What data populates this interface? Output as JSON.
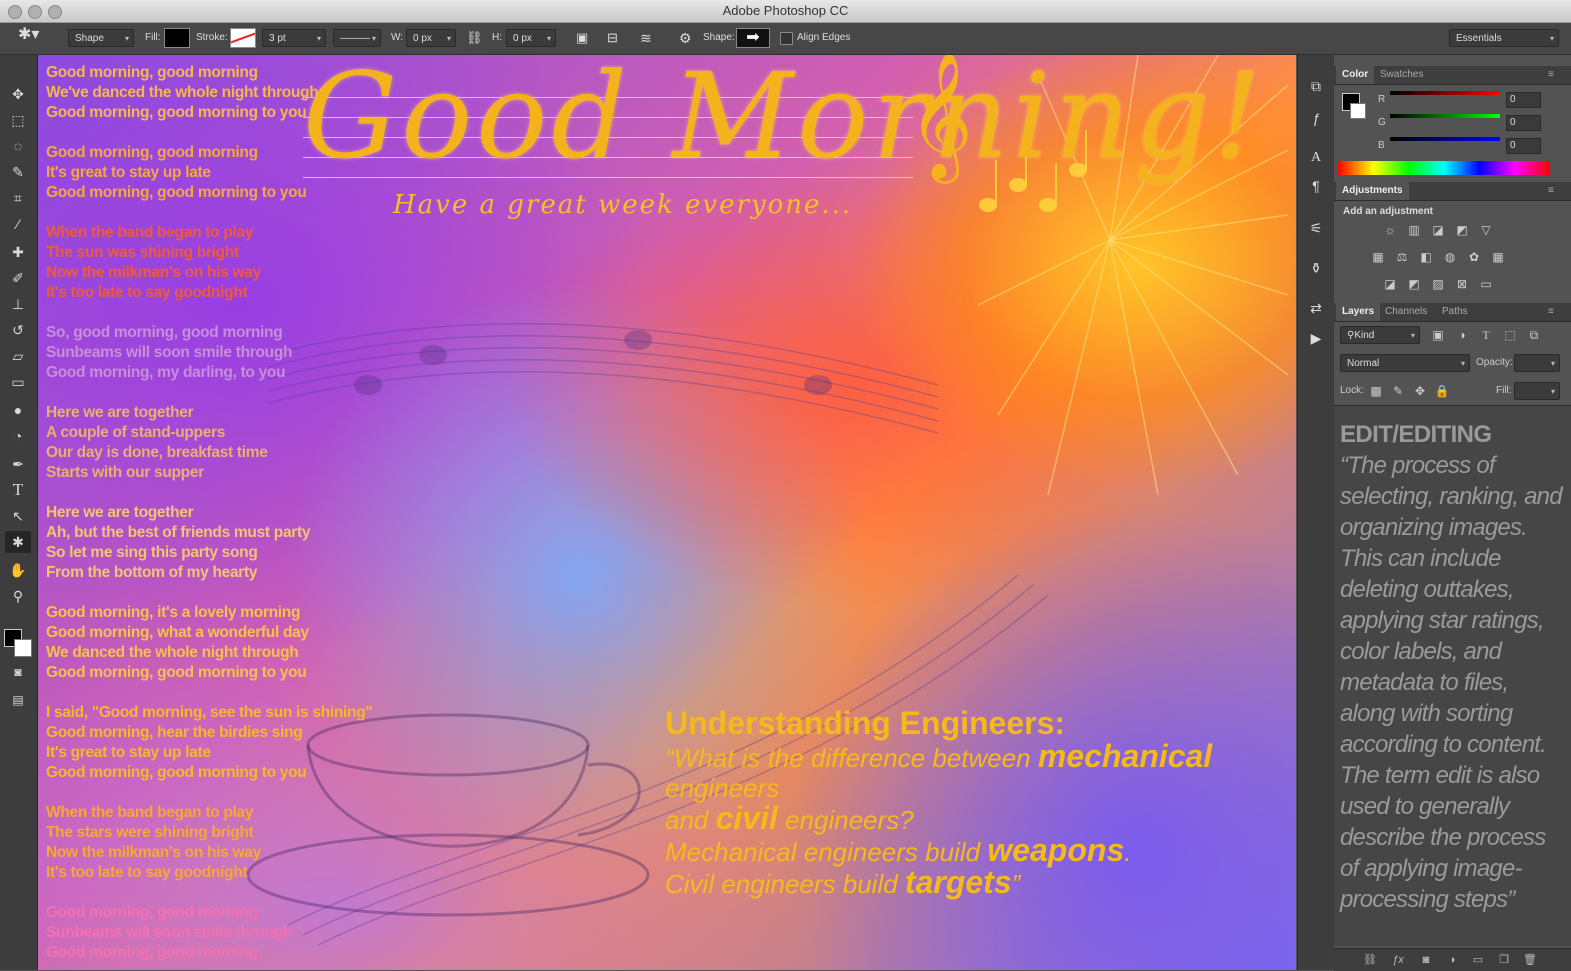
{
  "window": {
    "title": "Adobe Photoshop CC"
  },
  "options_bar": {
    "mode": "Shape",
    "fill_label": "Fill:",
    "stroke_label": "Stroke:",
    "stroke_width": "3 pt",
    "w_label": "W:",
    "w_value": "0 px",
    "h_label": "H:",
    "h_value": "0 px",
    "shape_label": "Shape:",
    "align_edges": "Align Edges",
    "workspace": "Essentials"
  },
  "canvas": {
    "lyrics": [
      {
        "color": "#f7b84a",
        "lines": [
          "Good morning, good morning",
          "We've danced the whole night through",
          "Good morning, good morning to you"
        ]
      },
      {
        "color": "#f7a83a",
        "lines": [
          "Good morning, good morning",
          "It's great to stay up late",
          "Good morning, good morning to you"
        ]
      },
      {
        "color": "#f05a3a",
        "lines": [
          "When the band began to play",
          "The sun was shining bright",
          "Now the milkman's on his way",
          "It's too late to say goodnight"
        ]
      },
      {
        "color": "#c88ed8",
        "lines": [
          "So, good morning, good morning",
          "Sunbeams will soon smile through",
          "Good morning, my darling, to you"
        ]
      },
      {
        "color": "#e9b070",
        "lines": [
          "Here we are together",
          "A couple of stand-uppers",
          "Our day is done, breakfast time",
          "Starts with our supper"
        ]
      },
      {
        "color": "#f2c572",
        "lines": [
          "Here we are together",
          "Ah, but the best of friends must party",
          "So let me sing this party song",
          "From the bottom of my hearty"
        ]
      },
      {
        "color": "#f7c24a",
        "lines": [
          "Good morning, it's a lovely morning",
          "Good morning, what a wonderful day",
          "We danced the whole night through",
          "Good morning, good morning to you"
        ]
      },
      {
        "color": "#f7b828",
        "lines": [
          "I said, \"Good morning, see the sun is shining\"",
          "Good morning, hear the birdies sing",
          "It's great to stay up late",
          "Good morning, good morning to you"
        ]
      },
      {
        "color": "#f7a830",
        "lines": [
          "When the band began to play",
          "The stars were shining bright",
          "Now the milkman's on his way",
          "It's too late to say goodnight"
        ]
      },
      {
        "color": "#f570b0",
        "lines": [
          "Good morning, good morning",
          "Sunbeams will soon smile through",
          "Good morning, good morning"
        ]
      }
    ],
    "headline": "Good Morning!",
    "subheadline": "Have a great week everyone...",
    "engineers_title": "Understanding Engineers:",
    "engineers_q1": "“What is the difference between ",
    "engineers_b1": "mechanical",
    "engineers_q2": " engineers",
    "engineers_q3": "and ",
    "engineers_b2": "civil",
    "engineers_q4": " engineers?",
    "engineers_q5": "Mechanical engineers build ",
    "engineers_b3": "weapons",
    "engineers_q6": ".",
    "engineers_q7": "Civil engineers build ",
    "engineers_b4": "targets",
    "engineers_q8": "”"
  },
  "panels": {
    "color_tab": "Color",
    "swatches_tab": "Swatches",
    "r_label": "R",
    "r_value": "0",
    "g_label": "G",
    "g_value": "0",
    "b_label": "B",
    "b_value": "0",
    "adjustments_tab": "Adjustments",
    "add_adjustment": "Add an adjustment",
    "layers_tab": "Layers",
    "channels_tab": "Channels",
    "paths_tab": "Paths",
    "kind": "Kind",
    "blend_mode": "Normal",
    "opacity_label": "Opacity:",
    "lock_label": "Lock:",
    "fill_label": "Fill:",
    "note_title": "EDIT/EDITING",
    "note_body": "“The process of selecting, ranking, and organizing images. This can include deleting outtakes, applying star ratings, color labels, and metadata to files, along with sorting according to content. The term edit is also used to generally describe the process of applying image-processing steps”"
  }
}
